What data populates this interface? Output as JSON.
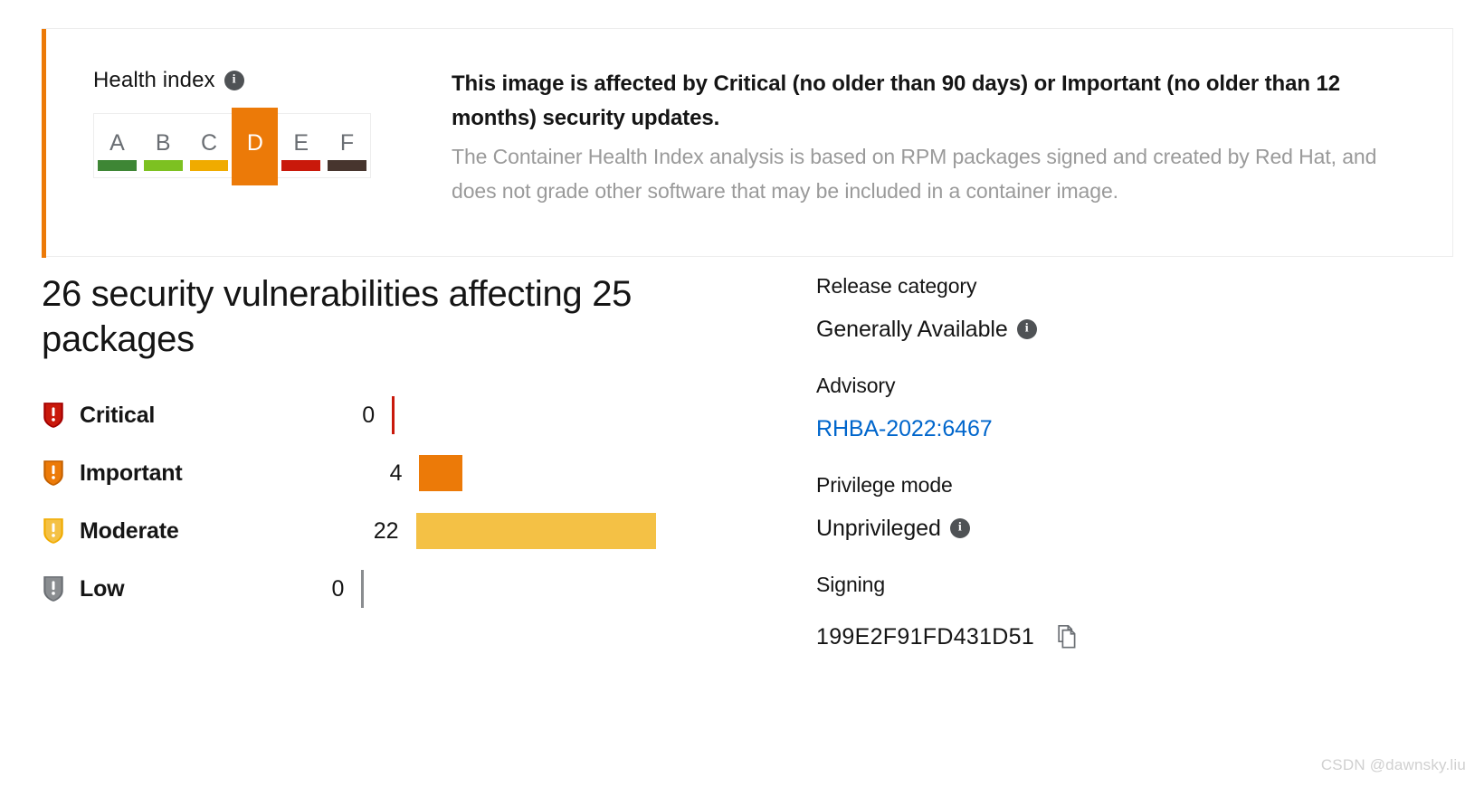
{
  "alert": {
    "health_index": {
      "title": "Health index",
      "info_icon": "info-icon",
      "grades": [
        "A",
        "B",
        "C",
        "D",
        "E",
        "F"
      ],
      "grade_colors": [
        "#3E8635",
        "#7DC121",
        "#F0AB00",
        "#EC7A08",
        "#C9190B",
        "#47352E"
      ],
      "active_grade": "D",
      "active_index": 3,
      "accent_color": "#EC7A08"
    },
    "title": "This image is affected by Critical (no older than 90 days) or Important (no older than 12 months) security updates.",
    "description": "The Container Health Index analysis is based on RPM packages signed and created by Red Hat, and does not grade other software that may be included in a container image."
  },
  "vulnerabilities": {
    "heading": "26 security vulnerabilities affecting 25 packages",
    "total": 26,
    "packages": 25,
    "severities": [
      {
        "label": "Critical",
        "count": "0",
        "value": 0,
        "color": "#C9190B",
        "icon": "shield-exclamation-icon"
      },
      {
        "label": "Important",
        "count": "4",
        "value": 4,
        "color": "#EC7A08",
        "icon": "shield-exclamation-icon"
      },
      {
        "label": "Moderate",
        "count": "22",
        "value": 22,
        "color": "#F4C145",
        "icon": "shield-exclamation-icon"
      },
      {
        "label": "Low",
        "count": "0",
        "value": 0,
        "color": "#8A8D90",
        "icon": "shield-exclamation-icon"
      }
    ]
  },
  "details": {
    "release_category": {
      "label": "Release category",
      "value": "Generally Available",
      "info_icon": "info-icon"
    },
    "advisory": {
      "label": "Advisory",
      "value": "RHBA-2022:6467",
      "link_color": "#0066cc"
    },
    "privilege_mode": {
      "label": "Privilege mode",
      "value": "Unprivileged",
      "info_icon": "info-icon"
    },
    "signing": {
      "label": "Signing",
      "value": "199E2F91FD431D51",
      "copy_icon": "copy-icon"
    }
  },
  "watermark": "CSDN @dawnsky.liu",
  "chart_data": {
    "type": "bar",
    "title": "26 security vulnerabilities affecting 25 packages",
    "orientation": "horizontal",
    "categories": [
      "Critical",
      "Important",
      "Moderate",
      "Low"
    ],
    "values": [
      0,
      4,
      22,
      0
    ],
    "colors": [
      "#C9190B",
      "#EC7A08",
      "#F4C145",
      "#8A8D90"
    ],
    "xlabel": "",
    "ylabel": "",
    "xlim": [
      0,
      22
    ],
    "grid": false,
    "legend": "none"
  }
}
